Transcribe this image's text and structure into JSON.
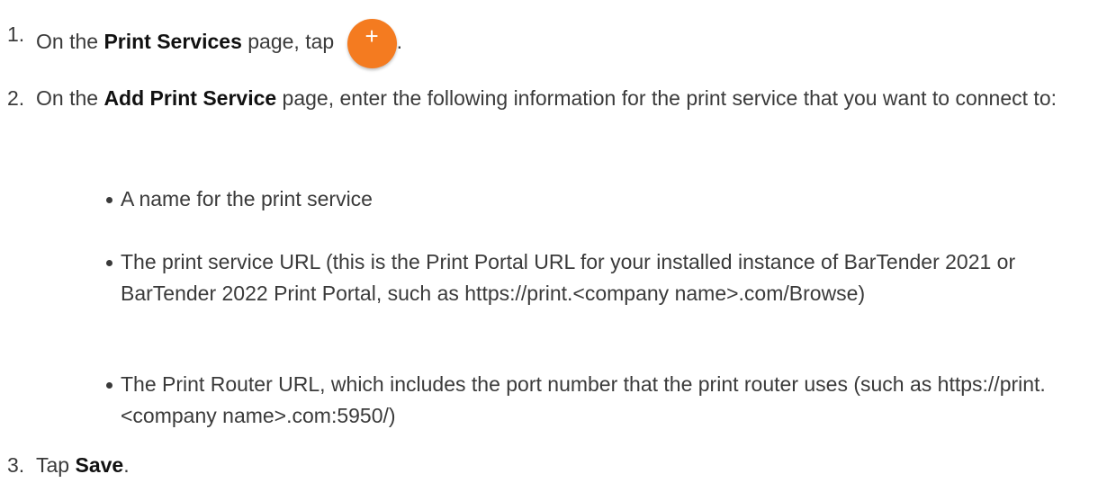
{
  "steps": [
    {
      "number": "1.",
      "prefix": "On the ",
      "term": "Print Services",
      "middle": " page, tap ",
      "icon": "add-plus-icon",
      "icon_color": "#f47b20",
      "icon_glyph": "+",
      "suffix": "."
    },
    {
      "number": "2.",
      "prefix": "On the ",
      "term": "Add Print Service",
      "suffix": " page, enter the following information for the print service that you want to connect to:"
    },
    {
      "number": "3.",
      "prefix": "Tap ",
      "term": "Save",
      "suffix": "."
    }
  ],
  "bullets": [
    "A name for the print service",
    "The print service URL (this is the Print Portal URL for your installed instance of BarTender 2021 or BarTender 2022 Print Portal, such as https://print.<company name>.com/Browse)",
    "The Print Router URL, which includes the port number that the print router uses (such as https://print.<company name>.com:5950/)"
  ]
}
